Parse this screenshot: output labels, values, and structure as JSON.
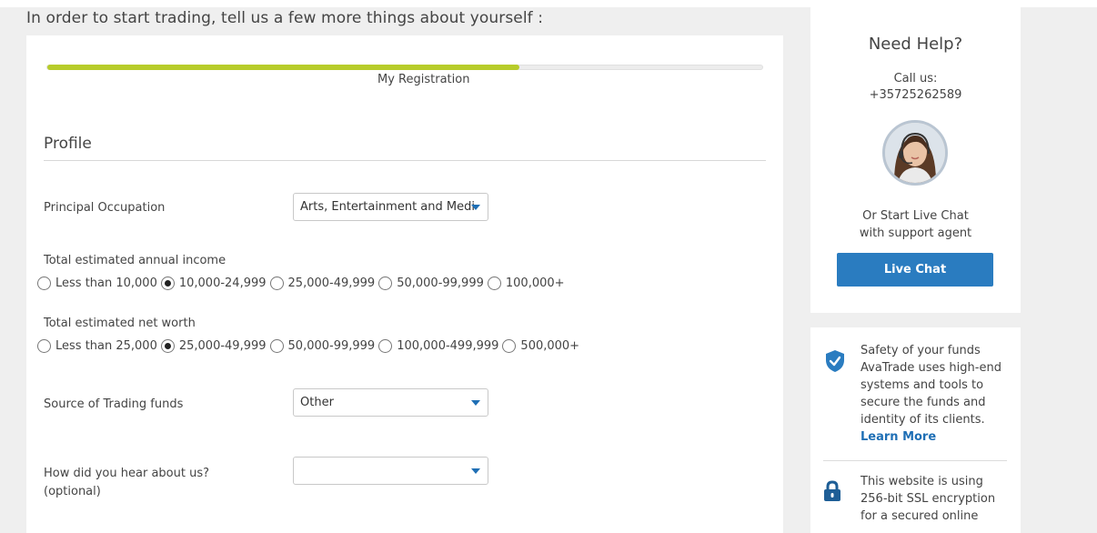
{
  "page": {
    "heading": "In order to start trading, tell us a few more things about yourself :"
  },
  "progress": {
    "label": "My Registration",
    "fraction": 0.66
  },
  "profile": {
    "section_title": "Profile",
    "occupation": {
      "label": "Principal Occupation",
      "value": "Arts, Entertainment and Medi"
    },
    "income": {
      "label": "Total estimated annual income",
      "options": [
        "Less than 10,000",
        "10,000-24,999",
        "25,000-49,999",
        "50,000-99,999",
        "100,000+"
      ],
      "selected_index": 1
    },
    "net_worth": {
      "label": "Total estimated net worth",
      "options": [
        "Less than 25,000",
        "25,000-49,999",
        "50,000-99,999",
        "100,000-499,999",
        "500,000+"
      ],
      "selected_index": 1
    },
    "funds_source": {
      "label": "Source of Trading funds",
      "value": "Other"
    },
    "hear_about": {
      "label_line1": "How did you hear about us?",
      "label_line2": "(optional)",
      "value": ""
    }
  },
  "help": {
    "title": "Need Help?",
    "call_label": "Call us:",
    "phone": "+35725262589",
    "chat_line1": "Or Start Live Chat",
    "chat_line2": "with support agent",
    "live_chat_button": "Live Chat"
  },
  "safety": {
    "funds_lines": [
      "Safety of your funds",
      "AvaTrade uses high-end",
      "systems and tools to",
      "secure the funds and",
      "identity of its clients."
    ],
    "learn_more": "Learn More",
    "ssl_lines": [
      "This website is using",
      "256-bit SSL encryption",
      "for a secured online"
    ]
  },
  "colors": {
    "progress_fill": "#b7cc2a",
    "button": "#2a7cc0",
    "link": "#1f6fb5",
    "shield_icon": "#2a7cc0",
    "lock_icon": "#1e5e96"
  }
}
